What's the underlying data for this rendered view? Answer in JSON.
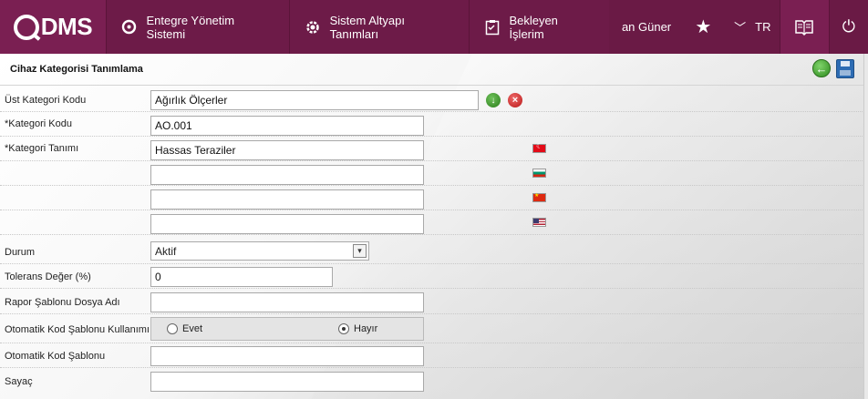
{
  "app": {
    "logo_text": "DMS"
  },
  "nav": {
    "items": [
      {
        "label": "Entegre Yönetim Sistemi",
        "icon": "q-logo-icon"
      },
      {
        "label": "Sistem Altyapı Tanımları",
        "icon": "gear-icon"
      },
      {
        "label": "Bekleyen İşlerim",
        "icon": "clipboard-icon"
      }
    ],
    "user": "an Güner",
    "language": "TR",
    "icons": [
      "star-icon",
      "chevron-down-icon",
      "book-icon",
      "power-icon"
    ]
  },
  "panel": {
    "title": "Cihaz Kategorisi Tanımlama",
    "actions": [
      "back-icon",
      "save-icon"
    ]
  },
  "form": {
    "ust_kategori": {
      "label": "Üst Kategori Kodu",
      "value": "Ağırlık Ölçerler"
    },
    "kategori_kodu": {
      "label": "*Kategori Kodu",
      "value": "AO.001"
    },
    "kategori_tanimi": {
      "label": "*Kategori Tanımı",
      "values": [
        "Hassas Teraziler",
        "",
        "",
        ""
      ],
      "flags": [
        "flag-tr-icon",
        "flag-bg-icon",
        "flag-cn-icon",
        "flag-us-icon"
      ]
    },
    "durum": {
      "label": "Durum",
      "value": "Aktif"
    },
    "tolerans": {
      "label": "Tolerans Değer (%)",
      "value": "0"
    },
    "rapor_sablonu": {
      "label": "Rapor Şablonu Dosya Adı",
      "value": ""
    },
    "otomatik_kod_kullanimi": {
      "label": "Otomatik Kod Şablonu Kullanımı",
      "option_yes": "Evet",
      "option_no": "Hayır",
      "selected": "Hayır"
    },
    "otomatik_kod_sablonu": {
      "label": "Otomatik Kod Şablonu",
      "value": ""
    },
    "sayac": {
      "label": "Sayaç",
      "value": ""
    }
  },
  "colors": {
    "topbar": "#6a1a45",
    "accent": "#7a1f52"
  }
}
